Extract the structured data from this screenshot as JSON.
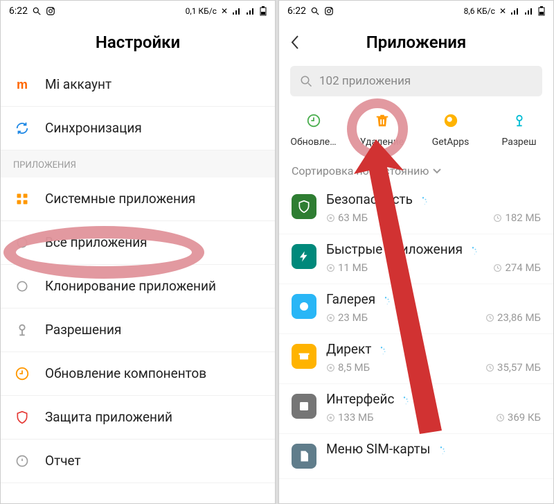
{
  "left": {
    "status": {
      "time": "6:22",
      "net": "0,1 КБ/с"
    },
    "title": "Настройки",
    "items_top": [
      {
        "label": "Mi аккаунт",
        "color": "#ff6700",
        "glyph": "m"
      },
      {
        "label": "Синхронизация",
        "color": "#1e88e5",
        "glyph": "sync"
      }
    ],
    "section": "ПРИЛОЖЕНИЯ",
    "items": [
      {
        "label": "Системные приложения",
        "color": "#ff9800",
        "glyph": "grid"
      },
      {
        "label": "Все приложения",
        "color": "#9e9e9e",
        "glyph": "circle"
      },
      {
        "label": "Клонирование приложений",
        "color": "#9e9e9e",
        "glyph": "circle"
      },
      {
        "label": "Разрешения",
        "color": "#9e9e9e",
        "glyph": "perm"
      },
      {
        "label": "Обновление компонентов",
        "color": "#ff9800",
        "glyph": "update"
      },
      {
        "label": "Защита приложений",
        "color": "#e53935",
        "glyph": "shield"
      },
      {
        "label": "Отчет",
        "color": "#9e9e9e",
        "glyph": "report"
      }
    ]
  },
  "right": {
    "status": {
      "time": "6:22",
      "net": "8,6 КБ/с"
    },
    "title": "Приложения",
    "search_placeholder": "102 приложения",
    "quick": [
      {
        "label": "Обновле…",
        "color": "#4caf50",
        "glyph": "update"
      },
      {
        "label": "Удаление",
        "color": "#ff9800",
        "glyph": "trash"
      },
      {
        "label": "GetApps",
        "color": "#ffb300",
        "glyph": "store"
      },
      {
        "label": "Разреш",
        "color": "#00bcd4",
        "glyph": "perm"
      }
    ],
    "sort_label": "Сортировка по состоянию",
    "apps": [
      {
        "name": "Безопасность",
        "size": "63 МБ",
        "time": "182 МБ",
        "bg": "#2e7d32",
        "glyph": "shield"
      },
      {
        "name": "Быстрые приложения",
        "size": "11 МБ",
        "time": "274 МБ",
        "bg": "#00897b",
        "glyph": "bolt"
      },
      {
        "name": "Галерея",
        "size": "23 МБ",
        "time": "23,86 МБ",
        "bg": "#29b6f6",
        "glyph": "gallery"
      },
      {
        "name": "Директ",
        "size": "8,5 МБ",
        "time": "35,57 МБ",
        "bg": "#ffb300",
        "glyph": "direct"
      },
      {
        "name": "Интерфейс",
        "size": "133 МБ",
        "time": "369 КБ",
        "bg": "#757575",
        "glyph": "ui"
      },
      {
        "name": "Меню SIM-карты",
        "size": "",
        "time": "",
        "bg": "#607d8b",
        "glyph": "sim"
      }
    ]
  }
}
